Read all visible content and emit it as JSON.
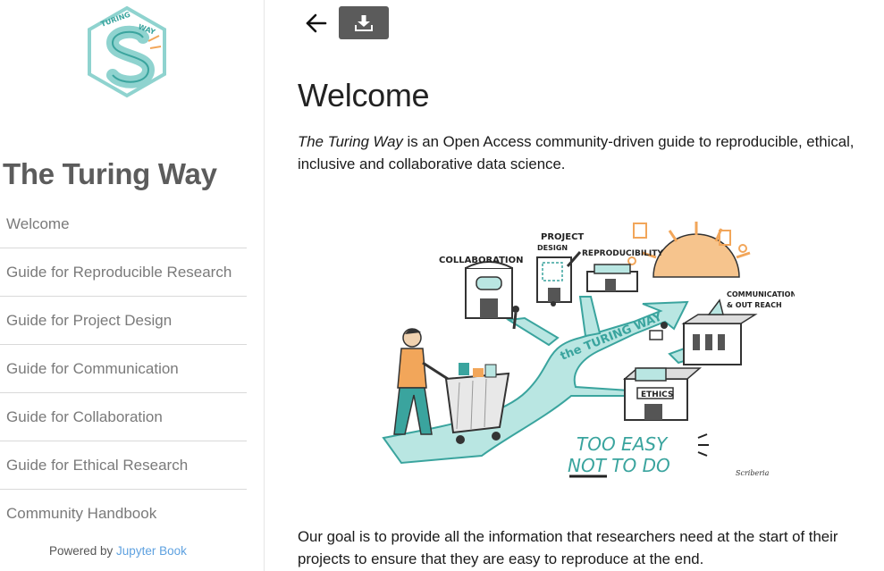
{
  "sidebar": {
    "logo_text": {
      "line1": "THE",
      "line2": "TURING",
      "line3": "WAY"
    },
    "title": "The Turing Way",
    "items": [
      {
        "label": "Welcome"
      },
      {
        "label": "Guide for Reproducible Research"
      },
      {
        "label": "Guide for Project Design"
      },
      {
        "label": "Guide for Communication"
      },
      {
        "label": "Guide for Collaboration"
      },
      {
        "label": "Guide for Ethical Research"
      },
      {
        "label": "Community Handbook"
      }
    ],
    "powered_prefix": "Powered by ",
    "powered_link": "Jupyter Book"
  },
  "toolbar": {
    "back_icon": "arrow-left-icon",
    "download_icon": "download-icon"
  },
  "main": {
    "title": "Welcome",
    "intro_em": "The Turing Way",
    "intro_rest": " is an Open Access community-driven guide to reproducible, ethical, inclusive and collaborative data science.",
    "illustration": {
      "labels": {
        "collaboration": "COLLABORATION",
        "project": "PROJECT",
        "design": "DESIGN",
        "reproducibility": "REPRODUCIBILITY",
        "communication": "COMMUNICATION",
        "outreach": "& OUT REACH",
        "path": "the TURING WAY",
        "ethics": "ETHICS",
        "too_easy": "TOO EASY",
        "not_to_do": "NOT TO DO",
        "signature": "Scriberia"
      }
    },
    "goal": "Our goal is to provide all the information that researchers need at the start of their projects to ensure that they are easy to reproduce at the end."
  },
  "colors": {
    "teal": "#8fd3cf",
    "teal_dark": "#3aa49e",
    "orange": "#f2a65a",
    "nav_text": "#7a7a7a",
    "link": "#5ea1e0"
  }
}
